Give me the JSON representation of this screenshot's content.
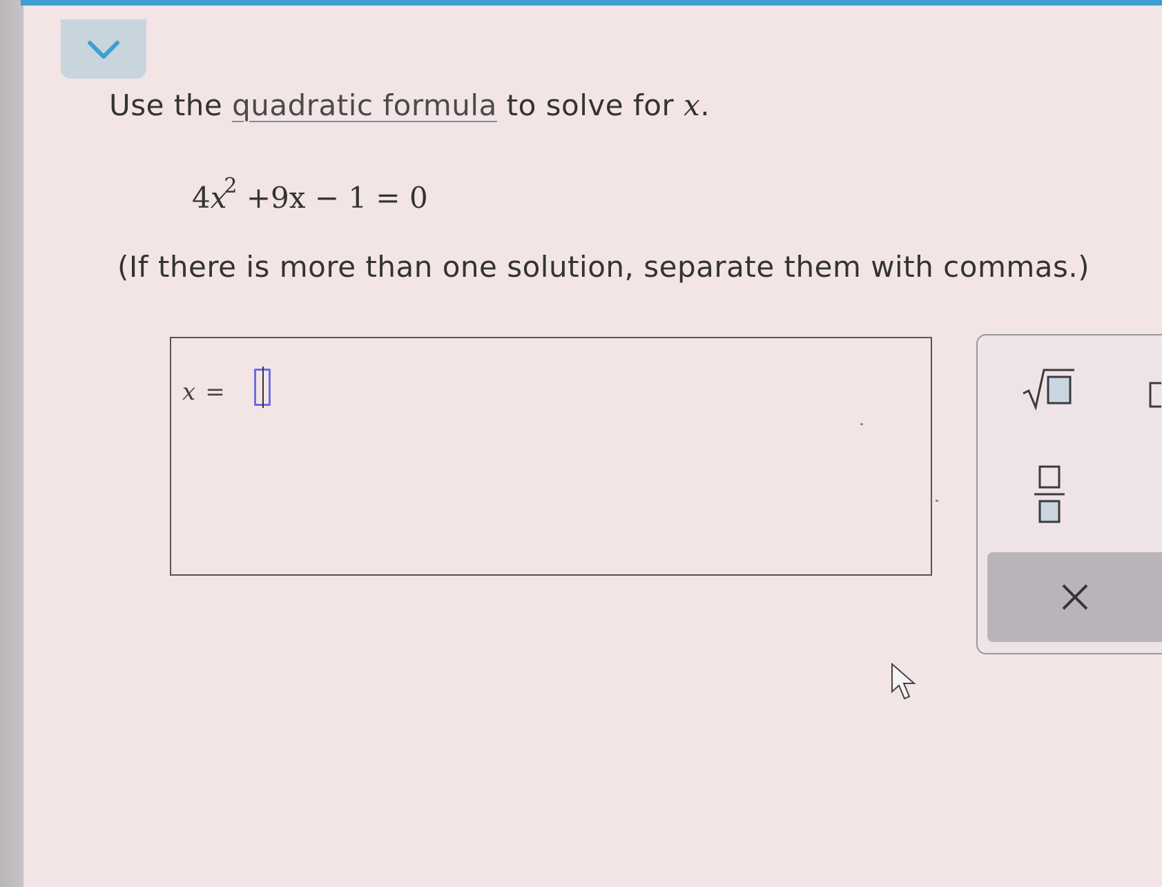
{
  "header": {
    "collapse_icon": "chevron-down-icon",
    "accent_color": "#3b9fd0"
  },
  "question": {
    "instruction_before": "Use the ",
    "instruction_link": "quadratic formula",
    "instruction_after": " to solve for ",
    "instruction_var": "x",
    "instruction_end": ".",
    "equation_lhs_coeff": "4",
    "equation_var": "x",
    "equation_exponent": "2",
    "equation_rest": " +9x − 1 = 0",
    "hint": "(If there is more than one solution, separate them with commas.)"
  },
  "answer": {
    "label_var": "x",
    "label_eq": "=",
    "value": ""
  },
  "palette": {
    "buttons": [
      {
        "name": "square-root",
        "icon": "sqrt-icon"
      },
      {
        "name": "fraction",
        "icon": "fraction-icon"
      },
      {
        "name": "bracket",
        "icon": "bracket-icon"
      }
    ],
    "clear_icon": "close-icon"
  }
}
